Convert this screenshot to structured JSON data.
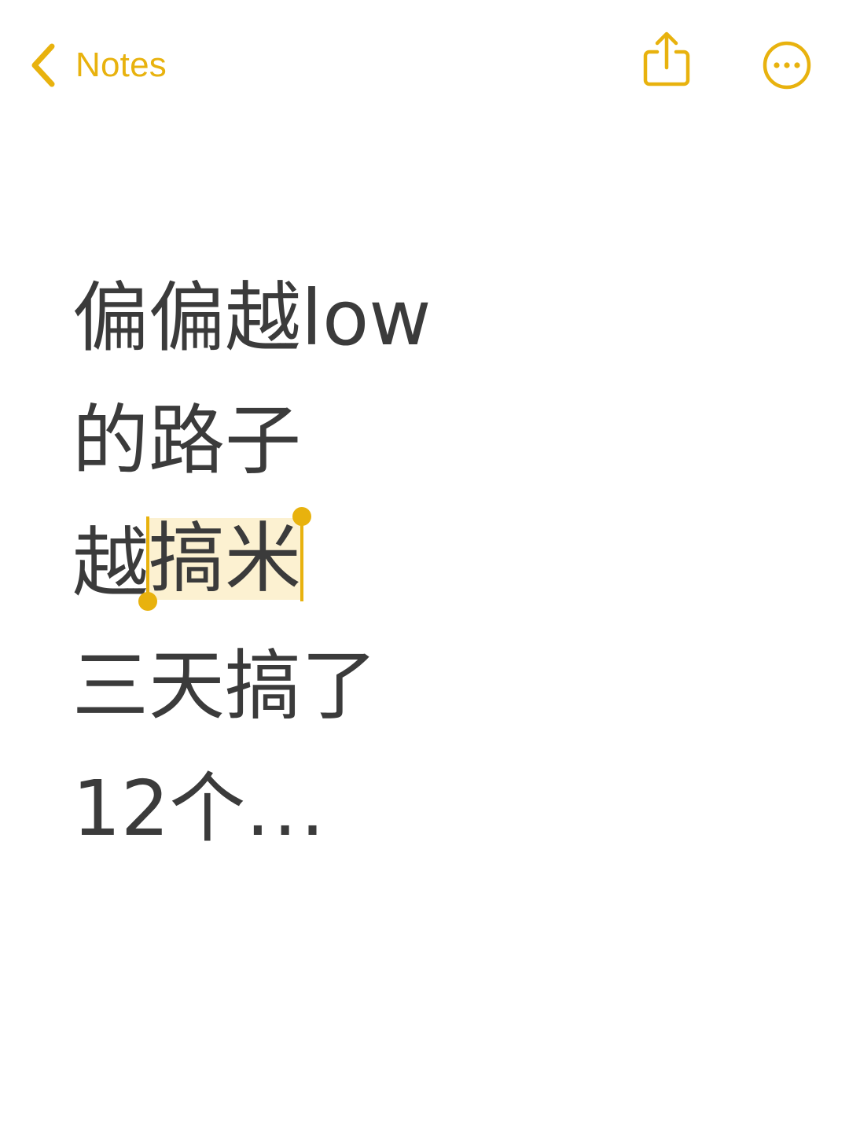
{
  "nav": {
    "back_label": "Notes",
    "back_icon": "chevron-left-icon",
    "share_icon": "share-icon",
    "more_icon": "ellipsis-circle-icon"
  },
  "note": {
    "line1": "偏偏越low",
    "line2": "的路子",
    "line3_before": "越",
    "line3_selected": "搞米",
    "line4": "三天搞了",
    "line5_main": "12个",
    "line5_ellipsis": "..."
  },
  "colors": {
    "accent": "#E8B20E",
    "text": "#3b3b3b",
    "selection_highlight": "#FCF1D1",
    "background": "#ffffff"
  }
}
